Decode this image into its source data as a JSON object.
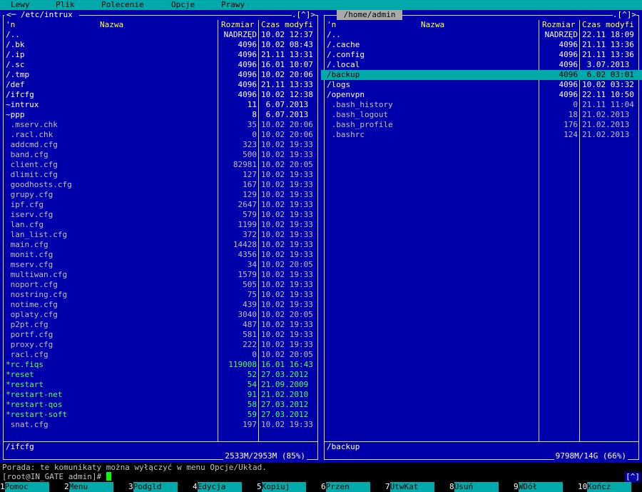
{
  "menu": [
    "Lewy",
    "Plik",
    "Polecenie",
    "Opcje",
    "Prawy"
  ],
  "left_panel": {
    "path": "/etc/intrux",
    "nav_left": "<",
    "nav_dash": "─",
    "nav_right": ".[^]>",
    "columns": {
      "sort": "'n",
      "name": "Nazwa",
      "size": "Rozmiar",
      "time": "Czas modyfi"
    },
    "files": [
      {
        "name": "/..",
        "size": "NADRZĘD",
        "time": "10.02 12:37",
        "type": "dir"
      },
      {
        "name": "/.bk",
        "size": "4096",
        "time": "10.02 08:43",
        "type": "dir"
      },
      {
        "name": "/.ip",
        "size": "4096",
        "time": "21.11 13:31",
        "type": "dir"
      },
      {
        "name": "/.sc",
        "size": "4096",
        "time": "16.01 10:07",
        "type": "dir"
      },
      {
        "name": "/.tmp",
        "size": "4096",
        "time": "10.02 20:06",
        "type": "dir"
      },
      {
        "name": "/def",
        "size": "4096",
        "time": "21.11 13:33",
        "type": "dir"
      },
      {
        "name": "/ifcfg",
        "size": "4096",
        "time": "10.02 12:38",
        "type": "dir"
      },
      {
        "name": "~intrux",
        "size": "11",
        "time": " 6.07.2013",
        "type": "dir"
      },
      {
        "name": "~ppp",
        "size": "8",
        "time": " 6.07.2013",
        "type": "dir"
      },
      {
        "name": " .mserv.chk",
        "size": "35",
        "time": "10.02 20:06",
        "type": "file"
      },
      {
        "name": " .racl.chk",
        "size": "0",
        "time": "10.02 20:06",
        "type": "file"
      },
      {
        "name": " addcmd.cfg",
        "size": "323",
        "time": "10.02 19:33",
        "type": "file"
      },
      {
        "name": " band.cfg",
        "size": "500",
        "time": "10.02 19:33",
        "type": "file"
      },
      {
        "name": " client.cfg",
        "size": "82981",
        "time": "10.02 20:05",
        "type": "file"
      },
      {
        "name": " dlimit.cfg",
        "size": "127",
        "time": "10.02 19:33",
        "type": "file"
      },
      {
        "name": " goodhosts.cfg",
        "size": "167",
        "time": "10.02 19:33",
        "type": "file"
      },
      {
        "name": " grupy.cfg",
        "size": "129",
        "time": "10.02 19:33",
        "type": "file"
      },
      {
        "name": " ipf.cfg",
        "size": "2647",
        "time": "10.02 19:33",
        "type": "file"
      },
      {
        "name": " iserv.cfg",
        "size": "579",
        "time": "10.02 19:33",
        "type": "file"
      },
      {
        "name": " lan.cfg",
        "size": "1199",
        "time": "10.02 19:33",
        "type": "file"
      },
      {
        "name": " lan_list.cfg",
        "size": "372",
        "time": "10.02 19:33",
        "type": "file"
      },
      {
        "name": " main.cfg",
        "size": "14428",
        "time": "10.02 19:33",
        "type": "file"
      },
      {
        "name": " monit.cfg",
        "size": "4356",
        "time": "10.02 19:33",
        "type": "file"
      },
      {
        "name": " mserv.cfg",
        "size": "34",
        "time": "10.02 20:05",
        "type": "file"
      },
      {
        "name": " multiwan.cfg",
        "size": "1579",
        "time": "10.02 19:33",
        "type": "file"
      },
      {
        "name": " noport.cfg",
        "size": "505",
        "time": "10.02 19:33",
        "type": "file"
      },
      {
        "name": " nostring.cfg",
        "size": "75",
        "time": "10.02 19:33",
        "type": "file"
      },
      {
        "name": " notime.cfg",
        "size": "439",
        "time": "10.02 19:33",
        "type": "file"
      },
      {
        "name": " oplaty.cfg",
        "size": "3040",
        "time": "10.02 20:05",
        "type": "file"
      },
      {
        "name": " p2pt.cfg",
        "size": "487",
        "time": "10.02 19:33",
        "type": "file"
      },
      {
        "name": " portf.cfg",
        "size": "581",
        "time": "10.02 19:33",
        "type": "file"
      },
      {
        "name": " proxy.cfg",
        "size": "222",
        "time": "10.02 19:33",
        "type": "file"
      },
      {
        "name": " racl.cfg",
        "size": "0",
        "time": "10.02 20:05",
        "type": "file"
      },
      {
        "name": "*rc.fiqs",
        "size": "119008",
        "time": "16.01 16:43",
        "type": "exe"
      },
      {
        "name": "*reset",
        "size": "52",
        "time": "27.03.2012",
        "type": "exe"
      },
      {
        "name": "*restart",
        "size": "54",
        "time": "21.09.2009",
        "type": "exe"
      },
      {
        "name": "*restart-net",
        "size": "91",
        "time": "21.02.2010",
        "type": "exe"
      },
      {
        "name": "*restart-qos",
        "size": "58",
        "time": "27.03.2012",
        "type": "exe"
      },
      {
        "name": "*restart-soft",
        "size": "59",
        "time": "27.03.2012",
        "type": "exe"
      },
      {
        "name": " snat.cfg",
        "size": "197",
        "time": "10.02 19:33",
        "type": "file"
      }
    ],
    "status": "/ifcfg",
    "free": "2533M/2953M (85%)"
  },
  "right_panel": {
    "path": "/home/admin",
    "nav_right": ".[^]>",
    "columns": {
      "sort": "'n",
      "name": "Nazwa",
      "size": "Rozmiar",
      "time": "Czas modyfi"
    },
    "files": [
      {
        "name": "/..",
        "size": "NADRZĘD",
        "time": "22.11 18:09",
        "type": "dir"
      },
      {
        "name": "/.cache",
        "size": "4096",
        "time": "21.11 13:36",
        "type": "dir"
      },
      {
        "name": "/.config",
        "size": "4096",
        "time": "21.11 13:36",
        "type": "dir"
      },
      {
        "name": "/.local",
        "size": "4096",
        "time": " 3.07.2013",
        "type": "dir"
      },
      {
        "name": "/backup",
        "size": "4096",
        "time": " 6.02 03:01",
        "type": "dir",
        "selected": true
      },
      {
        "name": "/logs",
        "size": "4096",
        "time": "10.02 03:32",
        "type": "dir"
      },
      {
        "name": "/openvpn",
        "size": "4096",
        "time": "22.11 10:50",
        "type": "dir"
      },
      {
        "name": " .bash_history",
        "size": "0",
        "time": "21.11 11:04",
        "type": "file"
      },
      {
        "name": " .bash_logout",
        "size": "18",
        "time": "21.02.2013",
        "type": "file"
      },
      {
        "name": " .bash_profile",
        "size": "176",
        "time": "21.02.2013",
        "type": "file"
      },
      {
        "name": " .bashrc",
        "size": "124",
        "time": "21.02.2013",
        "type": "file"
      }
    ],
    "status": "/backup",
    "free": "9798M/14G (66%)"
  },
  "hint": "Porada: te komunikaty można wyłączyć w menu Opcje/Układ.",
  "prompt": "[root@IN_GATE admin]# ",
  "cmd_history": "[^]",
  "fkeys": [
    {
      "num": "1",
      "label": "Pomoc"
    },
    {
      "num": "2",
      "label": "Menu"
    },
    {
      "num": "3",
      "label": "Podgld"
    },
    {
      "num": "4",
      "label": "Edycja"
    },
    {
      "num": "5",
      "label": "Kopiuj"
    },
    {
      "num": "6",
      "label": "Przen"
    },
    {
      "num": "7",
      "label": "UtwKat"
    },
    {
      "num": "8",
      "label": "Usuń"
    },
    {
      "num": "9",
      "label": "WDół"
    },
    {
      "num": "10",
      "label": "Kończ"
    }
  ],
  "colors": {
    "panel_bg": "#0000aa",
    "menu_bg": "#00aaaa",
    "selected_bg": "#00aaaa",
    "header_fg": "#ffff55",
    "exec_fg": "#55ff55",
    "cursor": "#00ff00"
  }
}
